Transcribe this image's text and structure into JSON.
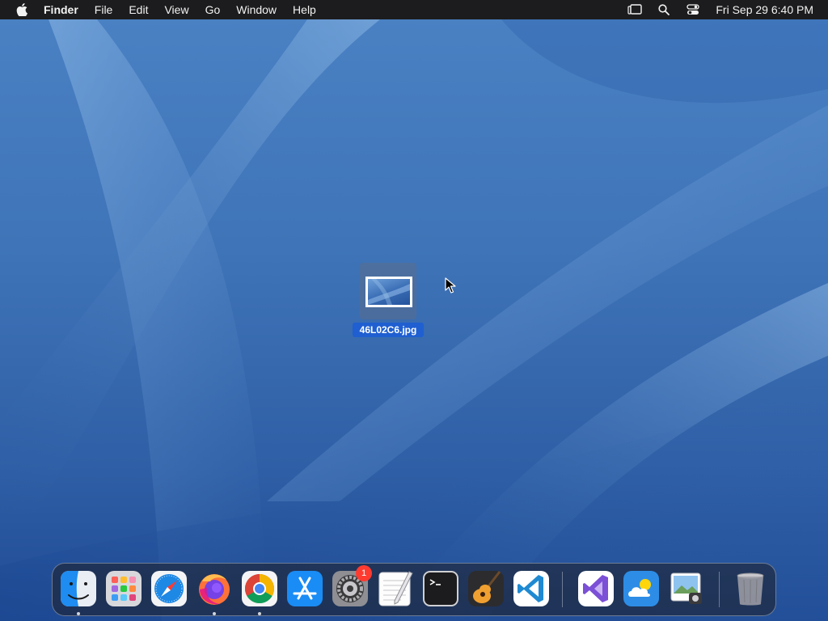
{
  "menubar": {
    "app_name": "Finder",
    "menus": [
      "File",
      "Edit",
      "View",
      "Go",
      "Window",
      "Help"
    ],
    "clock": "Fri Sep 29  6:40 PM"
  },
  "desktop": {
    "file": {
      "name": "46L02C6.jpg"
    }
  },
  "dock": {
    "apps": [
      {
        "name": "Finder",
        "icon": "finder-icon",
        "running": true
      },
      {
        "name": "Launchpad",
        "icon": "launchpad-icon",
        "running": false
      },
      {
        "name": "Safari",
        "icon": "safari-icon",
        "running": false
      },
      {
        "name": "Firefox",
        "icon": "firefox-icon",
        "running": true
      },
      {
        "name": "Chrome",
        "icon": "chrome-icon",
        "running": true
      },
      {
        "name": "App Store",
        "icon": "app-store-icon",
        "running": false
      },
      {
        "name": "System Settings",
        "icon": "system-settings-icon",
        "running": false,
        "badge": "1"
      },
      {
        "name": "TextEdit",
        "icon": "textedit-icon",
        "running": false
      },
      {
        "name": "Terminal",
        "icon": "terminal-icon",
        "running": false
      },
      {
        "name": "GarageBand",
        "icon": "garageband-icon",
        "running": false
      },
      {
        "name": "VS Code",
        "icon": "vscode-icon",
        "running": false
      },
      {
        "name": "Visual Studio",
        "icon": "visual-studio-icon",
        "running": false
      },
      {
        "name": "Weather",
        "icon": "weather-icon",
        "running": false
      },
      {
        "name": "Preview",
        "icon": "preview-icon",
        "running": false
      },
      {
        "name": "Trash",
        "icon": "trash-icon",
        "running": false
      }
    ]
  }
}
